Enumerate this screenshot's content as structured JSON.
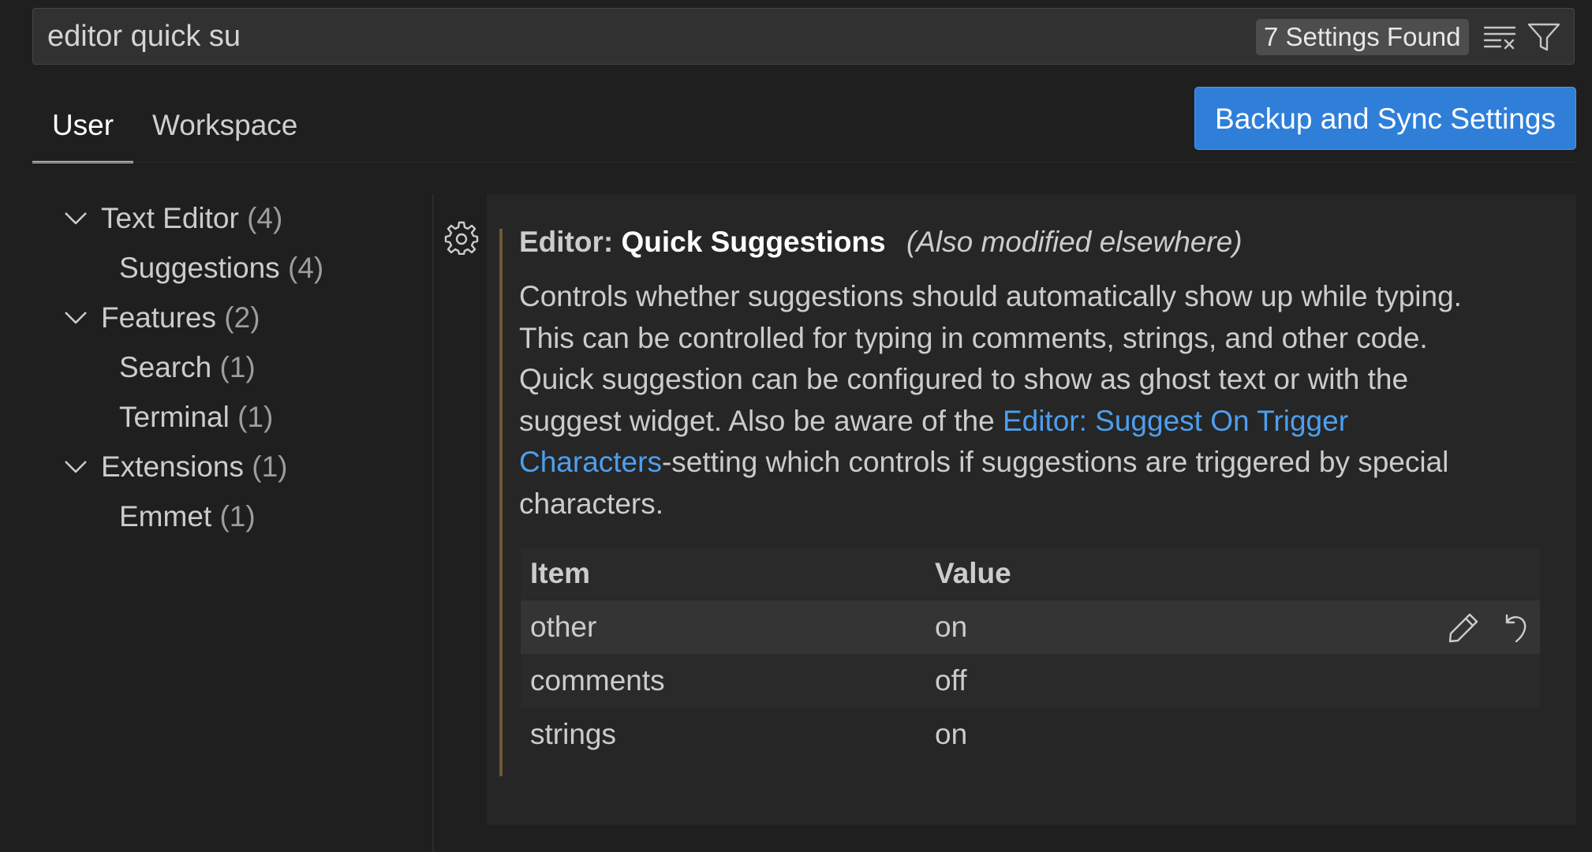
{
  "search": {
    "query": "editor quick su",
    "result_count": "7 Settings Found"
  },
  "tabs": [
    {
      "label": "User",
      "active": true
    },
    {
      "label": "Workspace",
      "active": false
    }
  ],
  "sync_button": "Backup and Sync Settings",
  "toc": [
    {
      "label": "Text Editor",
      "count": "(4)",
      "level": 0,
      "expanded": true
    },
    {
      "label": "Suggestions",
      "count": "(4)",
      "level": 1
    },
    {
      "label": "Features",
      "count": "(2)",
      "level": 0,
      "expanded": true
    },
    {
      "label": "Search",
      "count": "(1)",
      "level": 1
    },
    {
      "label": "Terminal",
      "count": "(1)",
      "level": 1
    },
    {
      "label": "Extensions",
      "count": "(1)",
      "level": 0,
      "expanded": true
    },
    {
      "label": "Emmet",
      "count": "(1)",
      "level": 1
    }
  ],
  "setting": {
    "category": "Editor:",
    "name": "Quick Suggestions",
    "modified_note": "(Also modified elsewhere)",
    "desc_line1": "Controls whether suggestions should automatically show up while typing.",
    "desc_line2": "This can be controlled for typing in comments, strings, and other code.",
    "desc_line3": "Quick suggestion can be configured to show as ghost text or with the",
    "desc_line4_pre": "suggest widget. Also be aware of the ",
    "desc_link_part1": "Editor: Suggest On Trigger",
    "desc_link_part2": "Characters",
    "desc_line5_post": "-setting which controls if suggestions are triggered by special",
    "desc_line6": "characters.",
    "table": {
      "headers": [
        "Item",
        "Value"
      ],
      "rows": [
        {
          "item": "other",
          "value": "on"
        },
        {
          "item": "comments",
          "value": "off"
        },
        {
          "item": "strings",
          "value": "on"
        }
      ]
    }
  },
  "icons": {
    "clear": "clear-filter-icon",
    "filter": "filter-icon",
    "gear": "gear-icon",
    "edit": "edit-icon",
    "reset": "reset-icon",
    "chevron": "chevron-down-icon"
  },
  "colors": {
    "accent": "#2f7fd9",
    "link": "#4d9fef",
    "modified_bar": "#6e5a37"
  }
}
